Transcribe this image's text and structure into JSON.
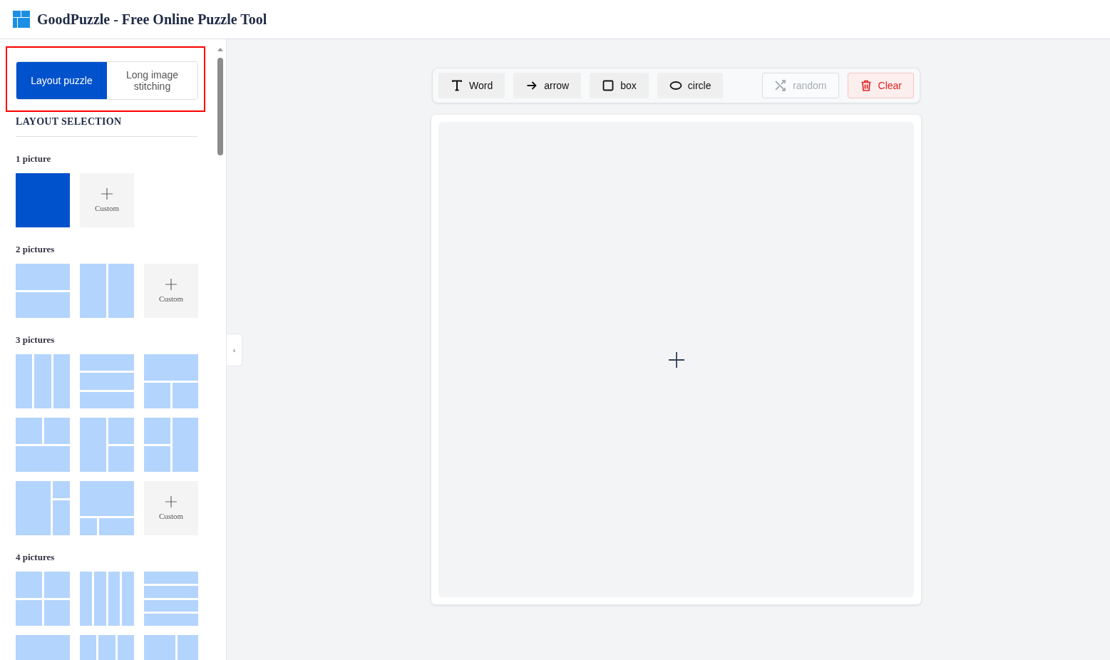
{
  "header": {
    "title": "GoodPuzzle - Free Online Puzzle Tool"
  },
  "mode_tabs": [
    {
      "label": "Layout puzzle",
      "selected": true
    },
    {
      "label": "Long image stitching",
      "selected": false
    }
  ],
  "sidebar": {
    "heading": "LAYOUT SELECTION",
    "groups": [
      {
        "title": "1 picture",
        "tiles": [
          {
            "kind": "single",
            "selected": true
          },
          {
            "kind": "custom",
            "label": "Custom",
            "selected": false
          }
        ]
      },
      {
        "title": "2 pictures",
        "tiles": [
          {
            "kind": "rows2",
            "selected": false
          },
          {
            "kind": "cols2",
            "selected": false
          },
          {
            "kind": "custom",
            "label": "Custom",
            "selected": false
          }
        ]
      },
      {
        "title": "3 pictures",
        "tiles": [
          {
            "kind": "cols3",
            "selected": false
          },
          {
            "kind": "rows3",
            "selected": false
          },
          {
            "kind": "top1bottom2",
            "selected": false
          },
          {
            "kind": "top2bottom1",
            "selected": false
          },
          {
            "kind": "left1right2",
            "selected": false
          },
          {
            "kind": "left2right1",
            "selected": false
          },
          {
            "kind": "bigleft",
            "selected": false
          },
          {
            "kind": "bigtop",
            "selected": false
          },
          {
            "kind": "custom",
            "label": "Custom",
            "selected": false
          }
        ]
      },
      {
        "title": "4 pictures",
        "tiles": [
          {
            "kind": "grid2x2",
            "selected": false
          },
          {
            "kind": "cols4",
            "selected": false
          },
          {
            "kind": "rows4",
            "selected": false
          },
          {
            "kind": "top1bottom3",
            "selected": false
          },
          {
            "kind": "top3bottom1",
            "selected": false
          },
          {
            "kind": "top2bottom2",
            "selected": false
          }
        ]
      }
    ]
  },
  "toolbar": {
    "tools": [
      {
        "kind": "text",
        "label": "Word"
      },
      {
        "kind": "arrow",
        "label": "arrow"
      },
      {
        "kind": "box",
        "label": "box"
      },
      {
        "kind": "circle",
        "label": "circle"
      }
    ],
    "random": {
      "label": "random",
      "disabled": true
    },
    "clear": {
      "label": "Clear"
    }
  },
  "collapse_handle": "‹"
}
